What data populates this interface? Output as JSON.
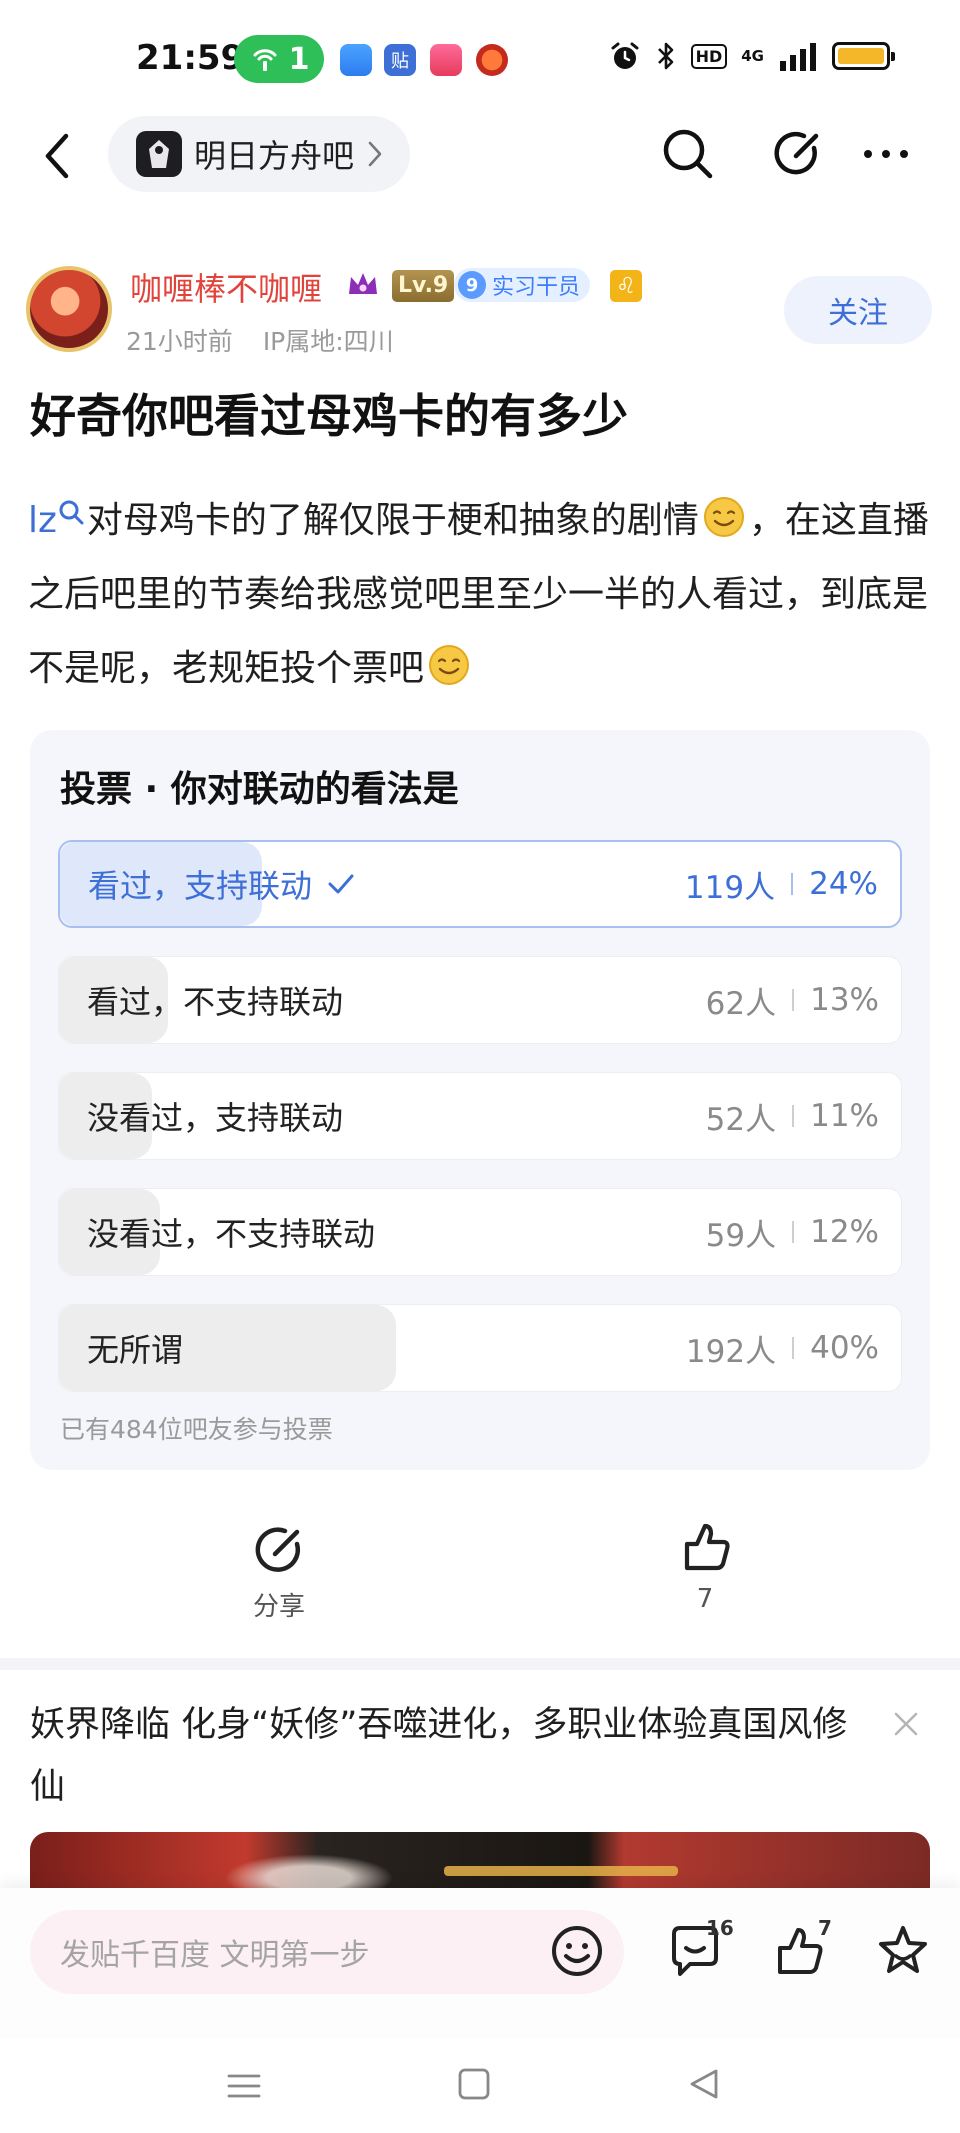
{
  "status_bar": {
    "time": "21:59",
    "hotspot_count": "1",
    "network": "4G",
    "hd_label": "HD"
  },
  "nav": {
    "forum_name": "明日方舟吧"
  },
  "author": {
    "name": "咖喱棒不咖喱",
    "level": "Lv.9",
    "role_num": "9",
    "role_label": "实习干员",
    "zodiac": "♌",
    "time_ago": "21小时前",
    "ip_location": "IP属地:四川",
    "follow_label": "关注"
  },
  "post": {
    "title": "好奇你吧看过母鸡卡的有多少",
    "lz_tag": "lz",
    "body_part1": "对母鸡卡的了解仅限于梗和抽象的剧情",
    "body_part2": "，在这直播之后吧里的节奏给我感觉吧里至少一半的人看过，到底是不是呢，老规矩投个票吧"
  },
  "vote": {
    "title": "投票 · 你对联动的看法是",
    "options": [
      {
        "label": "看过，支持联动",
        "count": "119人",
        "percent": "24%",
        "fraction": 0.24,
        "selected": true
      },
      {
        "label": "看过，不支持联动",
        "count": "62人",
        "percent": "13%",
        "fraction": 0.13,
        "selected": false
      },
      {
        "label": "没看过，支持联动",
        "count": "52人",
        "percent": "11%",
        "fraction": 0.11,
        "selected": false
      },
      {
        "label": "没看过，不支持联动",
        "count": "59人",
        "percent": "12%",
        "fraction": 0.12,
        "selected": false
      },
      {
        "label": "无所谓",
        "count": "192人",
        "percent": "40%",
        "fraction": 0.4,
        "selected": false
      }
    ],
    "footer": "已有484位吧友参与投票"
  },
  "actions": {
    "share_label": "分享",
    "like_count": "7"
  },
  "ad": {
    "title": "妖界降临 化身“妖修”吞噬进化，多职业体验真国风修仙"
  },
  "bottom_bar": {
    "reply_placeholder": "发贴千百度 文明第一步",
    "comment_count": "16",
    "like_count": "7"
  },
  "colors": {
    "accent": "#3d6fd6",
    "author_name": "#e0443c",
    "hotspot": "#2fbf59",
    "battery": "#f4b72a"
  }
}
